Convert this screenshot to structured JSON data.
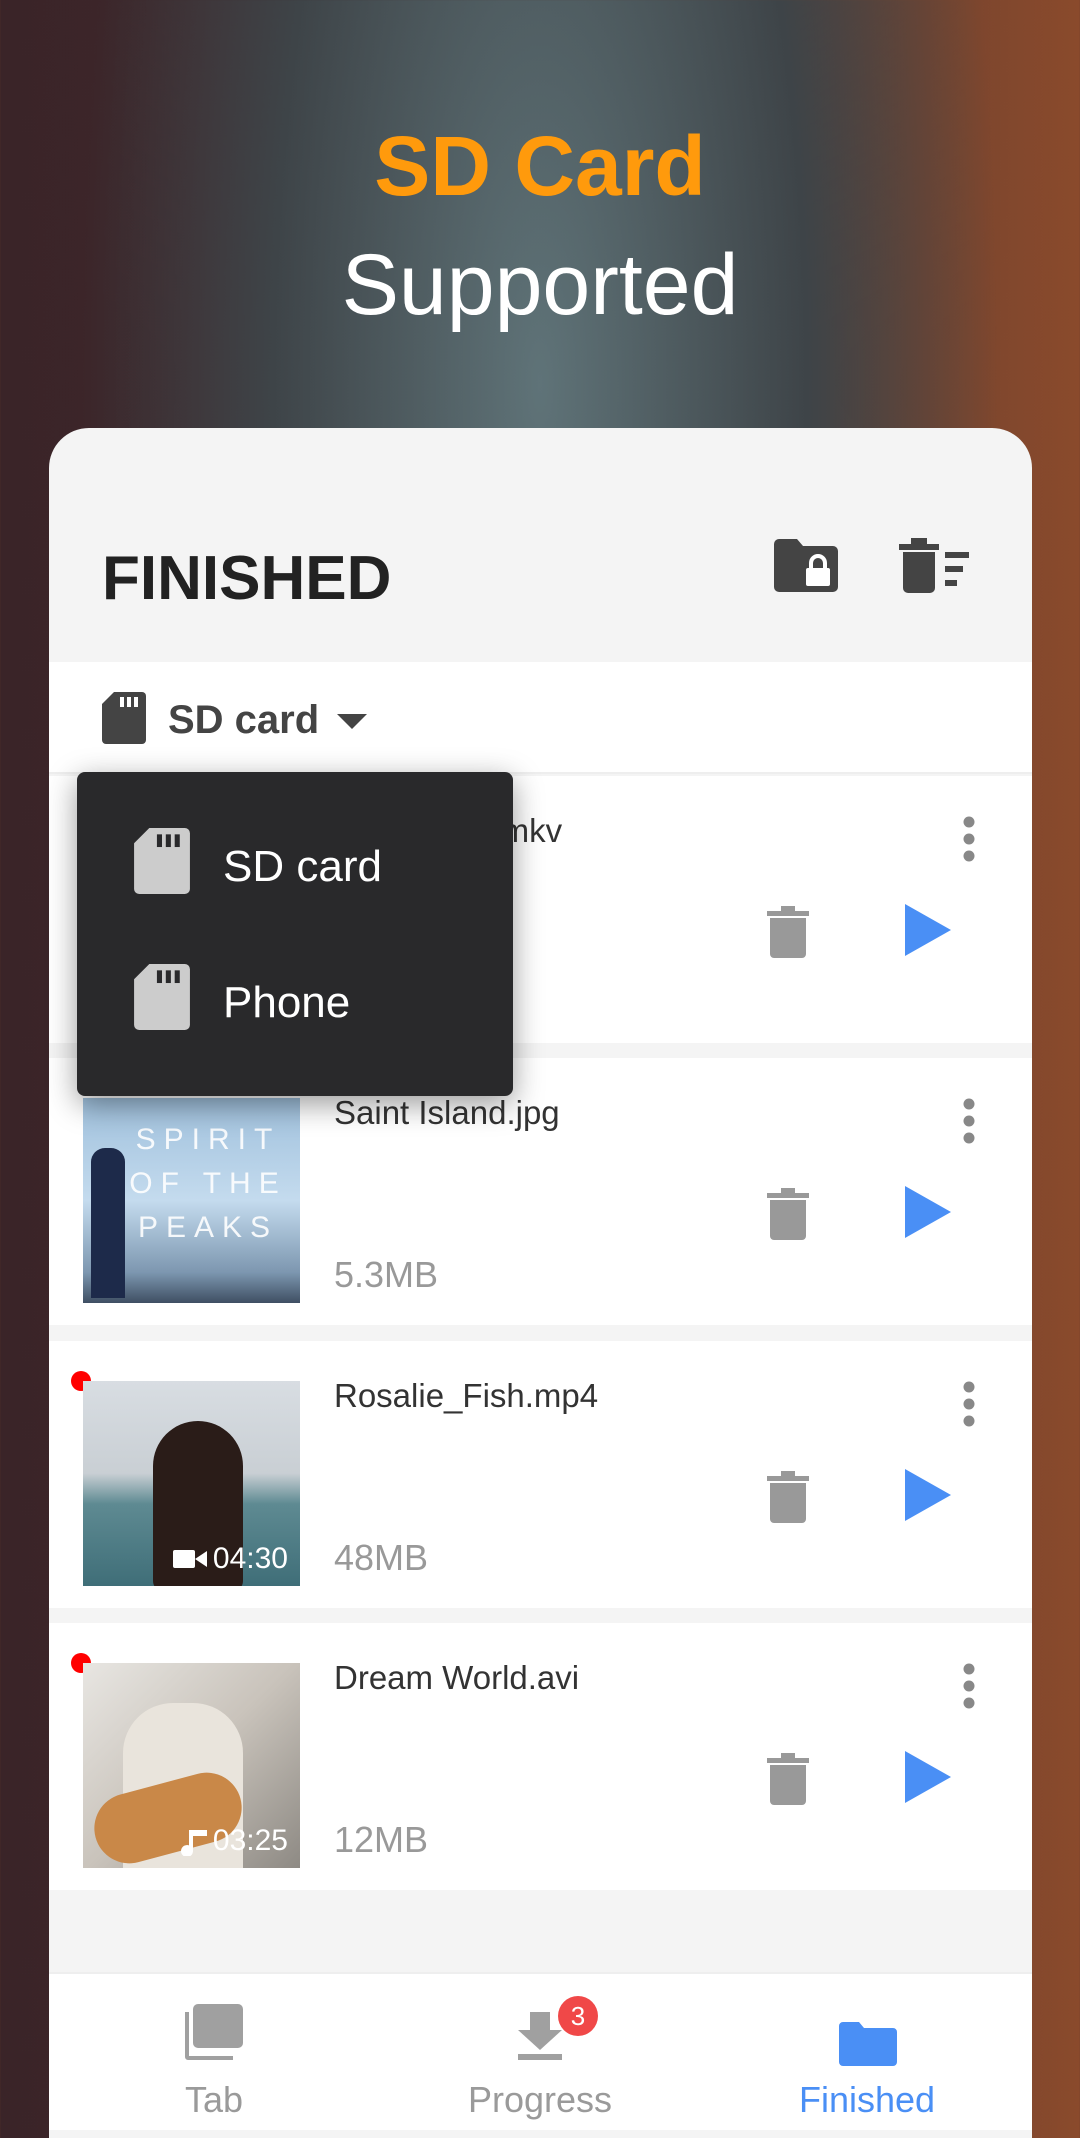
{
  "hero": {
    "line1": "SD Card",
    "line2": "Supported"
  },
  "header": {
    "title": "FINISHED",
    "icons": [
      "folder-lock-icon",
      "delete-sort-icon"
    ]
  },
  "storage": {
    "selected": "SD card",
    "options": [
      "SD card",
      "Phone"
    ]
  },
  "items": [
    {
      "name": "Sound of Y.mkv",
      "size": "",
      "duration": "",
      "new": false
    },
    {
      "name": "Saint Island.jpg",
      "size": "5.3MB",
      "duration": "",
      "new": false,
      "thumb_text": "SPIRIT OF THE PEAKS"
    },
    {
      "name": "Rosalie_Fish.mp4",
      "size": "48MB",
      "duration": "04:30",
      "new": true
    },
    {
      "name": "Dream World.avi",
      "size": "12MB",
      "duration": "03:25",
      "new": true
    }
  ],
  "nav": {
    "tab": "Tab",
    "progress": "Progress",
    "progress_badge": "3",
    "finished": "Finished",
    "active": "Finished"
  },
  "colors": {
    "accent": "#4a8ff5",
    "hero": "#ff9a0c",
    "badge": "#f04848"
  }
}
